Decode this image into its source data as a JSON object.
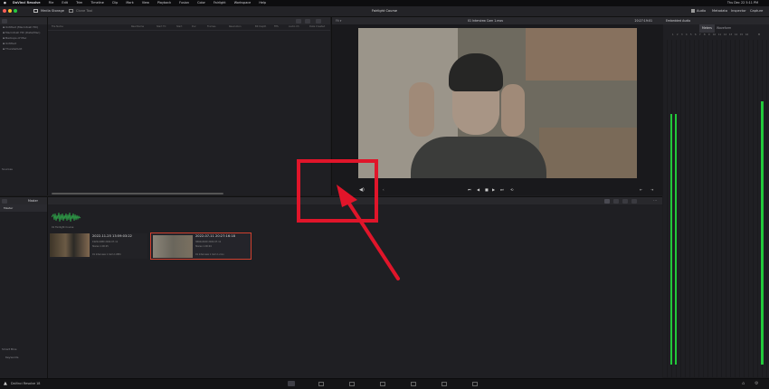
{
  "menu": {
    "app_name": "DaVinci Resolve",
    "items": [
      "File",
      "Edit",
      "Trim",
      "Timeline",
      "Clip",
      "Mark",
      "View",
      "Playback",
      "Fusion",
      "Color",
      "Fairlight",
      "Workspace",
      "Help"
    ],
    "clock": "Thu Dec 22  5:11 PM"
  },
  "toolbar": {
    "media_storage": "Media Storage",
    "clone_tool": "Clone Tool",
    "project_title": "Fairlight Course",
    "audio": "Audio",
    "metadata": "Metadata",
    "inspector": "Inspector",
    "capture": "Capture"
  },
  "storage": {
    "locations": [
      "Untitled (Macintosh HD)",
      "Macintosh HD (Data/Mac)",
      "Backups of Mac",
      "Untitled",
      "Thunderbolt"
    ],
    "columns": [
      "File Name",
      "Reel Name",
      "Start TC",
      "Start",
      "Dur",
      "Frames",
      "Resolution",
      "Bit Depth",
      "FPS",
      "Audio Ch",
      "Date Created"
    ]
  },
  "viewer": {
    "clip_name": "01 Interview Cam 1.mov",
    "timecode": "20:27:19:01"
  },
  "audio_panel": {
    "title": "Embedded Audio",
    "tabs": [
      "Meters",
      "Waveform"
    ],
    "channels": [
      "1",
      "2",
      "3",
      "4",
      "5",
      "6",
      "7",
      "8",
      "9",
      "10",
      "11",
      "12",
      "13",
      "14",
      "15",
      "16"
    ],
    "level_left": 0.78,
    "level_right": 0.78,
    "level_master": 0.82
  },
  "bins": {
    "sidebar_title": "Master",
    "sidebar_top": "Sources",
    "smart_bins": "Smart Bins",
    "smart_bins_item": "Keywords",
    "header": "Master"
  },
  "clips": [
    {
      "name": "01 Fairlight Course",
      "date": "",
      "meta1": "",
      "meta2": ""
    },
    {
      "name": "01 Interview 1 Cam 1.MP4",
      "date": "2022-11-25  13:59:03:22",
      "meta1": "1920x1080  2022-07-11",
      "meta2": "Stereo  1:00:25"
    },
    {
      "name": "01 Interview 1 Cam 1.mov",
      "date": "2022-07-11  20:27:16:18",
      "meta1": "3840x2160  2022-07-11",
      "meta2": "Stereo  1:00:04"
    }
  ],
  "statusbar": {
    "app": "DaVinci Resolve 18"
  }
}
